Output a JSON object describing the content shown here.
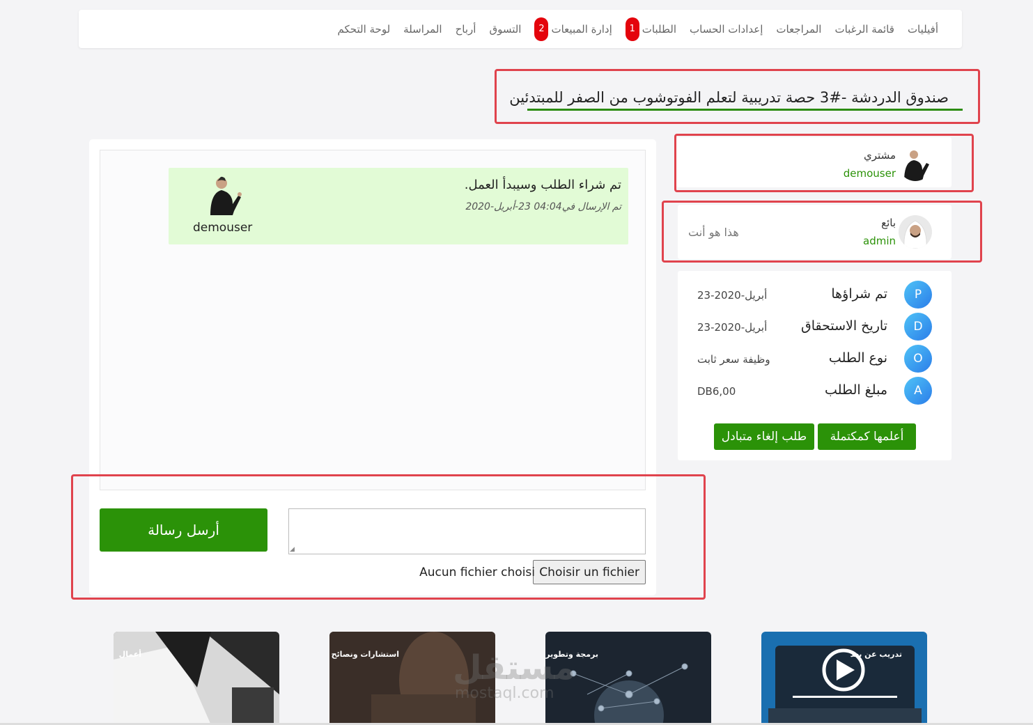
{
  "nav": {
    "items": [
      {
        "label": "لوحة التحكم"
      },
      {
        "label": "المراسلة"
      },
      {
        "label": "أرباح"
      },
      {
        "label": "التسوق"
      },
      {
        "label": "إدارة المبيعات",
        "badge": "2"
      },
      {
        "label": "الطلبات",
        "badge": "1"
      },
      {
        "label": "إعدادات الحساب"
      },
      {
        "label": "المراجعات"
      },
      {
        "label": "قائمة الرغبات"
      },
      {
        "label": "أفيليات"
      }
    ]
  },
  "page": {
    "title": "صندوق الدردشة -#3 حصة تدريبية لتعلم الفوتوشوب من الصفر للمبتدئين"
  },
  "chat": {
    "message": {
      "text": "تم شراء الطلب وسيبدأ العمل.",
      "time": "تم الإرسال في04:04 23-أبريل-2020",
      "user": "demouser"
    },
    "send_label": "أرسل رسالة",
    "input_value": "",
    "file_button": "Choisir un fichier",
    "file_status": "Aucun fichier choisi"
  },
  "buyer": {
    "role": "مشتري",
    "name": "demouser"
  },
  "seller": {
    "role": "بائع",
    "name": "admin",
    "note": "هذا هو أنت"
  },
  "details": [
    {
      "letter": "P",
      "label": "تم شراؤها",
      "value": "23-أبريل-2020"
    },
    {
      "letter": "D",
      "label": "تاريخ الاستحقاق",
      "value": "23-أبريل-2020"
    },
    {
      "letter": "O",
      "label": "نوع الطلب",
      "value": "وظيفة سعر ثابت"
    },
    {
      "letter": "A",
      "label": "مبلغ الطلب",
      "value": "DB6,00"
    }
  ],
  "actions": {
    "complete": "أعلمها كمكتملة",
    "cancel": "طلب إلغاء متبادل"
  },
  "categories": [
    {
      "label": "تدريب عن بعد",
      "color": "#1a6fb0"
    },
    {
      "label": "برمجة وتطوير",
      "color": "#1c2530"
    },
    {
      "label": "استشارات ونصائح",
      "color": "#3a2e28"
    },
    {
      "label": "أعمال",
      "color": "#6b6b6b"
    }
  ],
  "watermark": {
    "brand": "مستقل",
    "domain": "mostaql.com"
  },
  "colors": {
    "accent_green": "#2b9208",
    "badge_red": "#e4040c",
    "highlight_red": "#e0434d",
    "message_bg": "#e2fbd6"
  }
}
